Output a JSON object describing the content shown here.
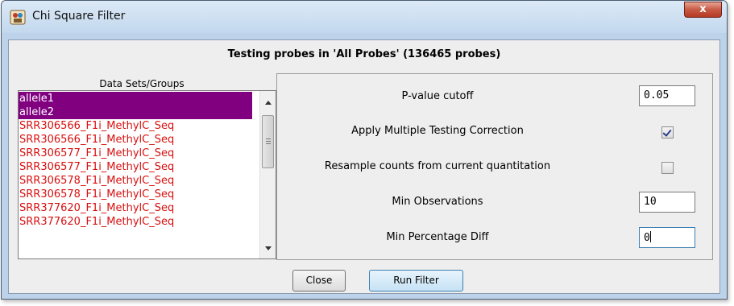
{
  "window": {
    "title": "Chi Square Filter",
    "close_glyph": "x",
    "app_icon": "seqmonk-icon"
  },
  "header": "Testing probes in 'All Probes' (136465 probes)",
  "groups": {
    "label": "Data Sets/Groups",
    "items": [
      {
        "label": "allele1",
        "selected": true
      },
      {
        "label": "allele2",
        "selected": true
      },
      {
        "label": "SRR306566_F1i_MethylC_Seq",
        "selected": false
      },
      {
        "label": "SRR306566_F1i_MethylC_Seq",
        "selected": false
      },
      {
        "label": "SRR306577_F1i_MethylC_Seq",
        "selected": false
      },
      {
        "label": "SRR306577_F1i_MethylC_Seq",
        "selected": false
      },
      {
        "label": "SRR306578_F1i_MethylC_Seq",
        "selected": false
      },
      {
        "label": "SRR306578_F1i_MethylC_Seq",
        "selected": false
      },
      {
        "label": "SRR377620_F1i_MethylC_Seq",
        "selected": false
      },
      {
        "label": "SRR377620_F1i_MethylC_Seq",
        "selected": false
      }
    ]
  },
  "options": {
    "pvalue": {
      "label": "P-value cutoff",
      "value": "0.05"
    },
    "multiple_testing": {
      "label": "Apply Multiple Testing Correction",
      "checked": true
    },
    "resample": {
      "label": "Resample counts from current quantitation",
      "checked": false
    },
    "min_observations": {
      "label": "Min Observations",
      "value": "10"
    },
    "min_percentage_diff": {
      "label": "Min Percentage Diff",
      "value": "0"
    }
  },
  "buttons": {
    "close": "Close",
    "run": "Run Filter"
  },
  "colors": {
    "selected_bg": "#800080",
    "item_text": "#d80f0f",
    "titlebar": "#c3d8ee"
  }
}
